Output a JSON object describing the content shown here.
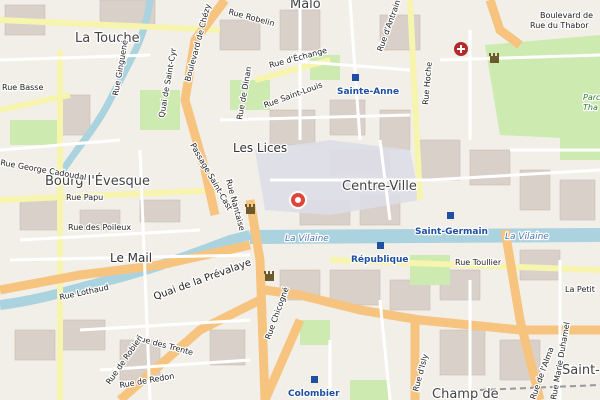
{
  "map": {
    "districts": [
      "Malo",
      "La Touche",
      "Les Lices",
      "Bourg l'Évesque",
      "Centre-Ville",
      "Le Mail",
      "Champ de",
      "Saint-"
    ],
    "streets": [
      "Boulevard de Chézy",
      "Rue Robelin",
      "Boulevard de",
      "Rue du Thabor",
      "Quai de Saint-Cyr",
      "Rue d'Échange",
      "Rue de Dinan",
      "Rue Saint-Louis",
      "Rue d'Antrain",
      "Rue Hoche",
      "Rue Basse",
      "Rue Papu",
      "Rue des Poileux",
      "Rue Lothaud",
      "Quai de la Prévalaye",
      "Passage Saint-Cast",
      "Rue Nantaise",
      "Rue Toullier",
      "Rue Chicogné",
      "Rue des Trente",
      "Rue de Redon",
      "Rue de Robien",
      "Rue Marie Duhamel",
      "Rue d'Isly",
      "Rue Ginguené",
      "Rue George Cadoudal",
      "Rue de l'Alma",
      "La Petit"
    ],
    "metro_stations": [
      "Sainte-Anne",
      "Saint-Germain",
      "République",
      "Colombier"
    ],
    "water_labels": [
      "La Vilaine",
      "La Vilaine"
    ],
    "park_labels": [
      "Parc du Thabor"
    ],
    "marker": "location-pin",
    "colors": {
      "water": "#aad3df",
      "major_road": "#f7c47f",
      "secondary_road": "#f6f4ad",
      "park": "#cdebb0",
      "building": "#d9d0c9",
      "pedestrian": "#dddde8",
      "marker": "#e0453b",
      "metro": "#1f4fa0"
    }
  }
}
